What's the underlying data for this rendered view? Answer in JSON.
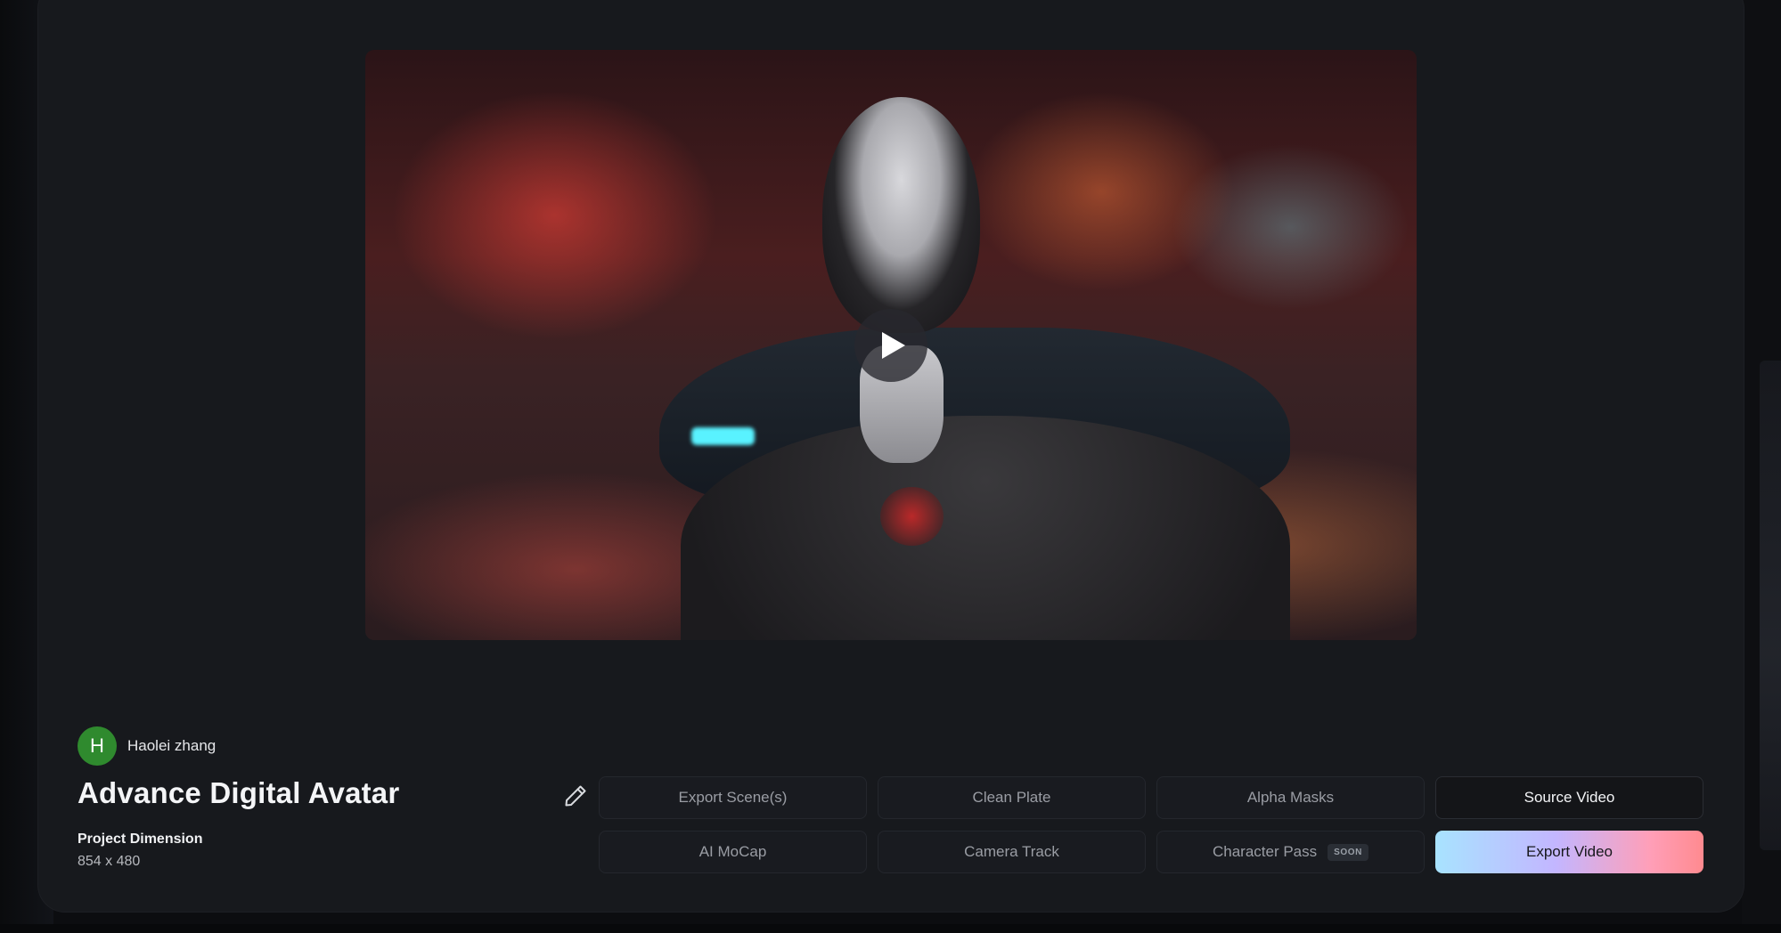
{
  "user": {
    "initial": "H",
    "name": "Haolei zhang",
    "avatar_color": "#2f8a2e"
  },
  "project": {
    "title": "Advance Digital Avatar",
    "dimension_label": "Project Dimension",
    "dimension_value": "854 x 480"
  },
  "video": {
    "play_icon": "play-icon",
    "edit_icon": "pencil-icon"
  },
  "actions": {
    "export_scenes": "Export Scene(s)",
    "clean_plate": "Clean Plate",
    "alpha_masks": "Alpha Masks",
    "source_video": "Source Video",
    "ai_mocap": "AI MoCap",
    "camera_track": "Camera Track",
    "character_pass": "Character Pass",
    "character_pass_badge": "SOON",
    "export_video": "Export Video"
  },
  "colors": {
    "panel_bg": "#17191d",
    "export_gradient": [
      "#a8e3ff",
      "#c3b6ff",
      "#ff9fb8",
      "#ff8a8f"
    ]
  }
}
